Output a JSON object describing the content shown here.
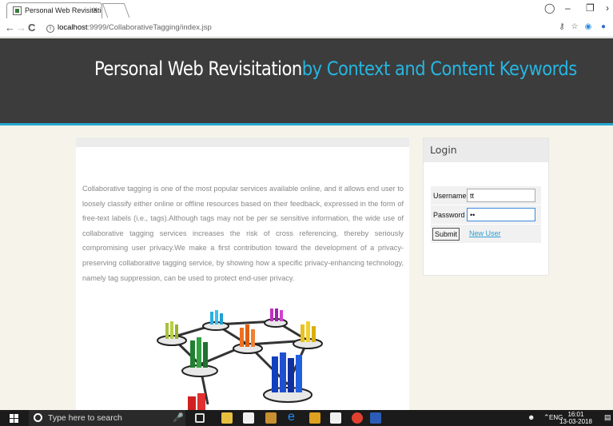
{
  "browser": {
    "tab_title": "Personal Web Revisitatio",
    "tab_close": "×",
    "url_host": "localhost",
    "url_path": ":9999/CollaborativeTagging/index.jsp",
    "back": "←",
    "forward": "→",
    "reload": "C",
    "info": "i"
  },
  "header": {
    "title_part1": "Personal Web Revisitation",
    "title_part2": "by Context and Content Keywords",
    "accent_color": "#27b5e0"
  },
  "intro_text": "Collaborative tagging is one of the most popular services available online, and it allows end user to loosely classify either online or offline resources based on their feedback, expressed in the form of free-text labels (i.e., tags).Although tags may not be per se sensitive information, the wide use of collaborative tagging services increases the risk of cross referencing, thereby seriously compromising user privacy.We make a first contribution toward the development of a privacy-preserving collaborative tagging service, by showing how a specific privacy-enhancing technology, namely tag suppression, can be used to protect end-user privacy.",
  "login": {
    "title": "Login",
    "username_label": "Username",
    "username_value": "tt",
    "password_label": "Password",
    "password_value": "••",
    "submit_label": "Submit",
    "new_user_label": "New User"
  },
  "taskbar": {
    "search_placeholder": "Type here to search",
    "lang": "ENG",
    "time": "16:01",
    "date": "13-03-2018"
  }
}
